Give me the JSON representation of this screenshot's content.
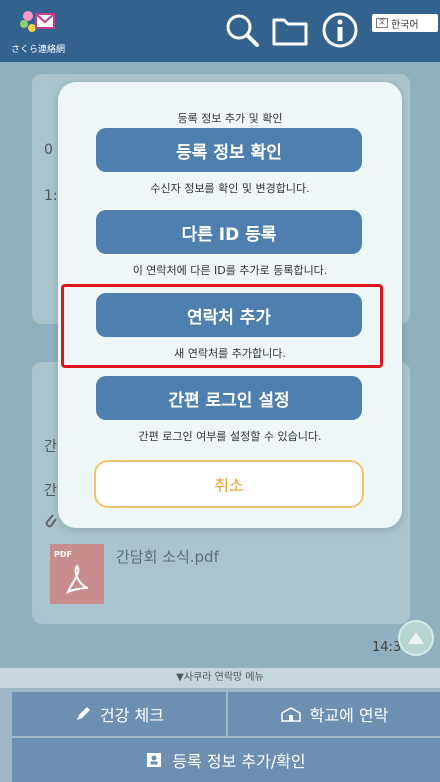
{
  "header": {
    "logo_text": "さくら連絡網",
    "language": "한국어"
  },
  "background": {
    "card_fragments": [
      "0",
      "1:",
      "간",
      "간"
    ],
    "attachment_name": "간담회 소식.pdf",
    "pdf_badge": "PDF",
    "time": "14:3",
    "menu_strip": "▼사쿠라 연락망 메뉴"
  },
  "modal": {
    "title": "등록 정보 추가 및 확인",
    "buttons": [
      {
        "label": "등록 정보 확인",
        "desc": "수신자 정보를 확인 및 변경합니다."
      },
      {
        "label": "다른 ID 등록",
        "desc": "이 연락처에 다른 ID를 추가로 등록합니다."
      },
      {
        "label": "연락처 추가",
        "desc": "새 연락처를 추가합니다."
      },
      {
        "label": "간편 로그인 설정",
        "desc": "간편 로그인 여부를 설정할 수 있습니다."
      }
    ],
    "cancel": "취소"
  },
  "bottom_bar": {
    "health": "건강 체크",
    "school": "학교에 연락",
    "register": "등록 정보 추가/확인"
  },
  "colors": {
    "header": "#34628f",
    "modal_button": "#4e7fae",
    "cancel_border": "#f1c46b",
    "cancel_text": "#e8a22a",
    "highlight": "#e0141d"
  },
  "icons": [
    "search-icon",
    "folder-icon",
    "info-icon",
    "language-icon",
    "pen-icon",
    "school-icon",
    "contact-card-icon",
    "arrow-up-icon",
    "pdf-icon",
    "paperclip-icon"
  ]
}
